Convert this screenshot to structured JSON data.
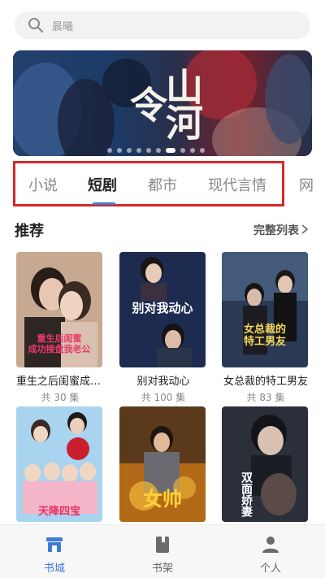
{
  "search": {
    "placeholder": "晨曦"
  },
  "banner": {
    "title": "山河令",
    "dots": 10,
    "active_dot": 6
  },
  "tabs": [
    "小说",
    "短剧",
    "都市",
    "现代言情",
    "网"
  ],
  "active_tab": 1,
  "section": {
    "title": "推荐",
    "more": "完整列表"
  },
  "dramas": [
    {
      "title": "重生之后闺蜜成功接盘我老公",
      "episodes": "共 30 集",
      "cover_text": "重生后闺蜜\n成功接盘我老公"
    },
    {
      "title": "别对我动心",
      "episodes": "共 100 集",
      "cover_text": "别对我动心"
    },
    {
      "title": "女总裁的特工男友",
      "episodes": "共 83 集",
      "cover_text": "女总裁的\n特工男友"
    },
    {
      "title": "",
      "episodes": "",
      "cover_text": "天降四宝"
    },
    {
      "title": "",
      "episodes": "",
      "cover_text": "女帅"
    },
    {
      "title": "",
      "episodes": "",
      "cover_text": "双面娇妻"
    }
  ],
  "nav": [
    {
      "label": "书城",
      "icon": "store-icon",
      "active": true
    },
    {
      "label": "书架",
      "icon": "bookshelf-icon",
      "active": false
    },
    {
      "label": "个人",
      "icon": "person-icon",
      "active": false
    }
  ],
  "colors": {
    "accent": "#3d7bd8",
    "highlight_frame": "#d62828",
    "nav_bg": "#f7f7f7",
    "search_bg": "#f2f2f2"
  }
}
